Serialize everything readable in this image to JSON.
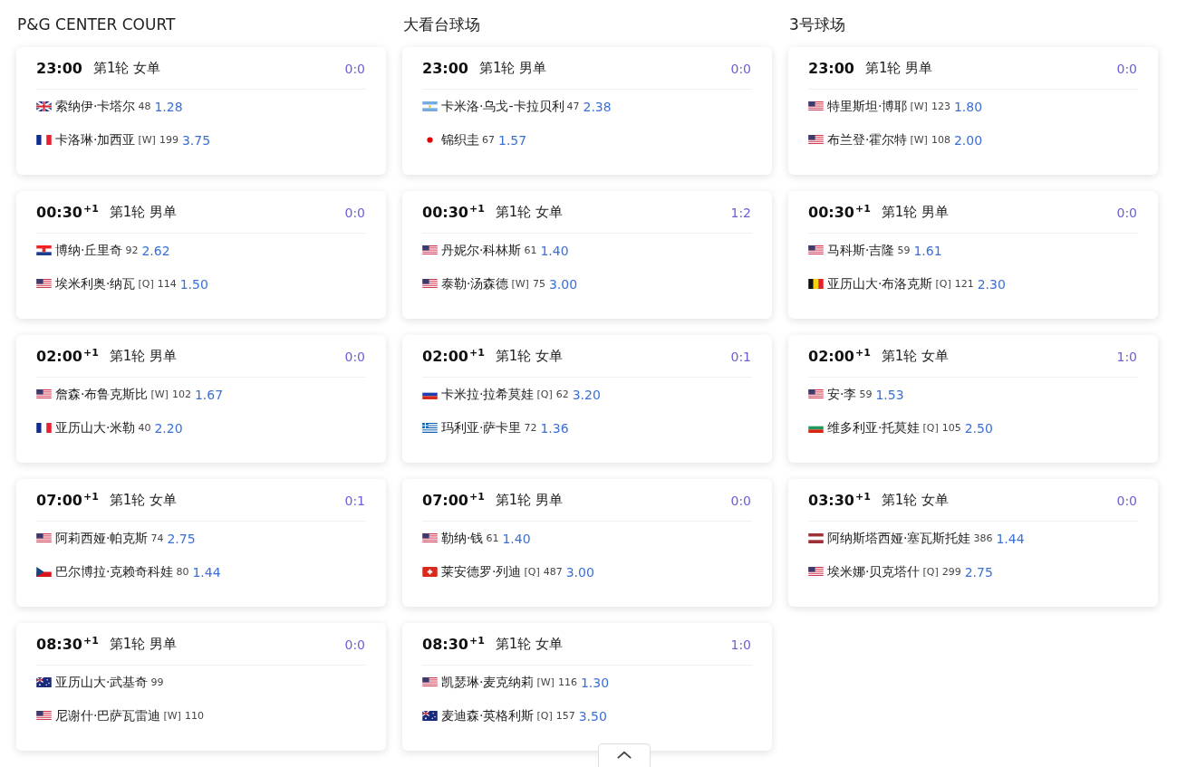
{
  "courts": [
    {
      "name": "P&G CENTER COURT",
      "matches": [
        {
          "time": "23:00",
          "round": "第1轮 女单",
          "score": "0:0",
          "players": [
            {
              "kind": "gb",
              "name": "索纳伊·卡塔尔",
              "rank": "48",
              "odds": "1.28"
            },
            {
              "kind": "fr",
              "name": "卡洛琳·加西亚",
              "seed": "[W]",
              "rank": "199",
              "odds": "3.75"
            }
          ]
        },
        {
          "time": "00:30",
          "day_offset": "+1",
          "round": "第1轮 男单",
          "score": "0:0",
          "players": [
            {
              "kind": "hr",
              "name": "博纳·丘里奇",
              "rank": "92",
              "odds": "2.62"
            },
            {
              "kind": "us",
              "name": "埃米利奥·纳瓦",
              "seed": "[Q]",
              "rank": "114",
              "odds": "1.50"
            }
          ]
        },
        {
          "time": "02:00",
          "day_offset": "+1",
          "round": "第1轮 男单",
          "score": "0:0",
          "players": [
            {
              "kind": "us",
              "name": "詹森·布鲁克斯比",
              "seed": "[W]",
              "rank": "102",
              "odds": "1.67"
            },
            {
              "kind": "fr",
              "name": "亚历山大·米勒",
              "rank": "40",
              "odds": "2.20"
            }
          ]
        },
        {
          "time": "07:00",
          "day_offset": "+1",
          "round": "第1轮 女单",
          "score": "0:1",
          "players": [
            {
              "kind": "us",
              "name": "阿莉西娅·帕克斯",
              "rank": "74",
              "odds": "2.75"
            },
            {
              "kind": "cz",
              "name": "巴尔博拉·克赖奇科娃",
              "rank": "80",
              "odds": "1.44"
            }
          ]
        },
        {
          "time": "08:30",
          "day_offset": "+1",
          "round": "第1轮 男单",
          "score": "0:0",
          "players": [
            {
              "kind": "au",
              "name": "亚历山大·武基奇",
              "rank": "99"
            },
            {
              "kind": "us",
              "name": "尼谢什·巴萨瓦雷迪",
              "seed": "[W]",
              "rank": "110"
            }
          ]
        }
      ]
    },
    {
      "name": "大看台球场",
      "matches": [
        {
          "time": "23:00",
          "round": "第1轮 男单",
          "score": "0:0",
          "players": [
            {
              "kind": "ar",
              "name": "卡米洛·乌戈-卡拉贝利",
              "rank": "47",
              "odds": "2.38"
            },
            {
              "kind": "jp",
              "name": "锦织圭",
              "rank": "67",
              "odds": "1.57"
            }
          ]
        },
        {
          "time": "00:30",
          "day_offset": "+1",
          "round": "第1轮 女单",
          "score": "1:2",
          "players": [
            {
              "kind": "us",
              "name": "丹妮尔·科林斯",
              "rank": "61",
              "odds": "1.40"
            },
            {
              "kind": "us",
              "name": "泰勒·汤森德",
              "seed": "[W]",
              "rank": "75",
              "odds": "3.00"
            }
          ]
        },
        {
          "time": "02:00",
          "day_offset": "+1",
          "round": "第1轮 女单",
          "score": "0:1",
          "players": [
            {
              "kind": "ru",
              "name": "卡米拉·拉希莫娃",
              "seed": "[Q]",
              "rank": "62",
              "odds": "3.20"
            },
            {
              "kind": "gr",
              "name": "玛利亚·萨卡里",
              "rank": "72",
              "odds": "1.36"
            }
          ]
        },
        {
          "time": "07:00",
          "day_offset": "+1",
          "round": "第1轮 男单",
          "score": "0:0",
          "players": [
            {
              "kind": "us",
              "name": "勒纳·钱",
              "rank": "61",
              "odds": "1.40"
            },
            {
              "kind": "ch",
              "name": "莱安德罗·列迪",
              "seed": "[Q]",
              "rank": "487",
              "odds": "3.00"
            }
          ]
        },
        {
          "time": "08:30",
          "day_offset": "+1",
          "round": "第1轮 女单",
          "score": "1:0",
          "players": [
            {
              "kind": "us",
              "name": "凯瑟琳·麦克纳莉",
              "seed": "[W]",
              "rank": "116",
              "odds": "1.30"
            },
            {
              "kind": "au",
              "name": "麦迪森·英格利斯",
              "seed": "[Q]",
              "rank": "157",
              "odds": "3.50"
            }
          ]
        }
      ]
    },
    {
      "name": "3号球场",
      "matches": [
        {
          "time": "23:00",
          "round": "第1轮 男单",
          "score": "0:0",
          "players": [
            {
              "kind": "us",
              "name": "特里斯坦·博耶",
              "seed": "[W]",
              "rank": "123",
              "odds": "1.80"
            },
            {
              "kind": "us",
              "name": "布兰登·霍尔特",
              "seed": "[W]",
              "rank": "108",
              "odds": "2.00"
            }
          ]
        },
        {
          "time": "00:30",
          "day_offset": "+1",
          "round": "第1轮 男单",
          "score": "0:0",
          "players": [
            {
              "kind": "us",
              "name": "马科斯·吉隆",
              "rank": "59",
              "odds": "1.61"
            },
            {
              "kind": "be",
              "name": "亚历山大·布洛克斯",
              "seed": "[Q]",
              "rank": "121",
              "odds": "2.30"
            }
          ]
        },
        {
          "time": "02:00",
          "day_offset": "+1",
          "round": "第1轮 女单",
          "score": "1:0",
          "players": [
            {
              "kind": "us",
              "name": "安·李",
              "rank": "59",
              "odds": "1.53"
            },
            {
              "kind": "bg",
              "name": "维多利亚·托莫娃",
              "seed": "[Q]",
              "rank": "105",
              "odds": "2.50"
            }
          ]
        },
        {
          "time": "03:30",
          "day_offset": "+1",
          "round": "第1轮 女单",
          "score": "0:0",
          "players": [
            {
              "kind": "lv",
              "name": "阿纳斯塔西娅·塞瓦斯托娃",
              "rank": "386",
              "odds": "1.44"
            },
            {
              "kind": "us",
              "name": "埃米娜·贝克塔什",
              "seed": "[Q]",
              "rank": "299",
              "odds": "2.75"
            }
          ]
        }
      ]
    }
  ]
}
